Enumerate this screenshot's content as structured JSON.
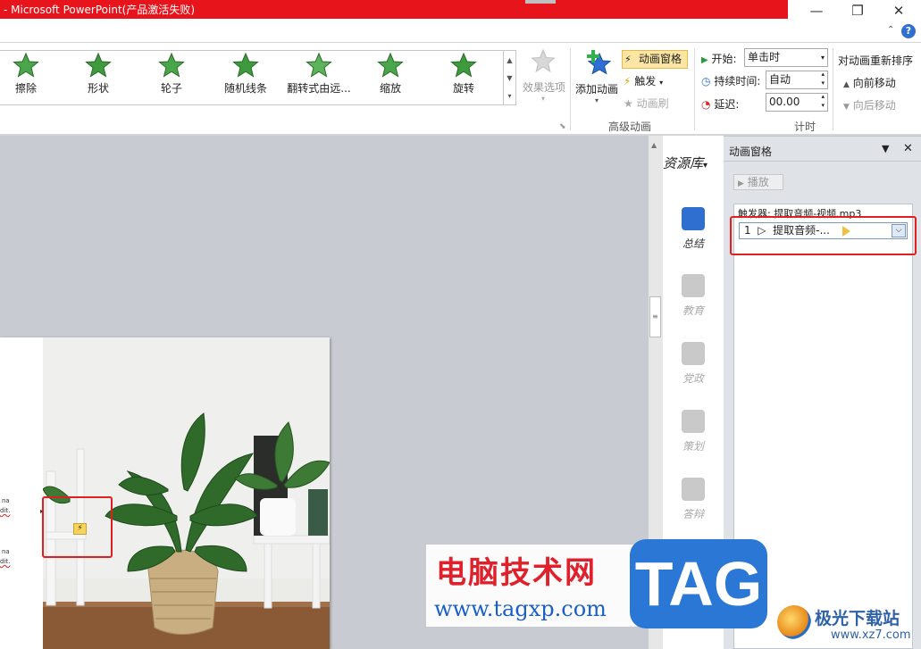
{
  "window": {
    "title": "- Microsoft PowerPoint(产品激活失败)",
    "minimize_icon": "minimize-icon",
    "restore_icon": "restore-icon",
    "close_icon": "close-icon"
  },
  "ribbon": {
    "gallery": [
      {
        "label": "擦除",
        "icon": "star-wipe-icon"
      },
      {
        "label": "形状",
        "icon": "star-shape-icon"
      },
      {
        "label": "轮子",
        "icon": "star-wheel-icon"
      },
      {
        "label": "随机线条",
        "icon": "star-random-bars-icon"
      },
      {
        "label": "翻转式由远...",
        "icon": "star-flip-icon"
      },
      {
        "label": "缩放",
        "icon": "star-zoom-icon"
      },
      {
        "label": "旋转",
        "icon": "star-spin-icon"
      }
    ],
    "effect_options": "效果选项",
    "add_animation": "添加动画",
    "animation_pane_btn": "动画窗格",
    "trigger": "触发",
    "animation_painter": "动画刷",
    "advanced_group": "高级动画",
    "start_label": "开始:",
    "start_value": "单击时",
    "duration_label": "持续时间:",
    "duration_value": "自动",
    "delay_label": "延迟:",
    "delay_value": "00.00",
    "timing_group": "计时",
    "reorder_title": "对动画重新排序",
    "move_earlier": "向前移动",
    "move_later": "向后移动"
  },
  "sidebar": {
    "header": "资源库",
    "items": [
      {
        "label": "总结",
        "active": true
      },
      {
        "label": "教育",
        "active": false
      },
      {
        "label": "党政",
        "active": false
      },
      {
        "label": "策划",
        "active": false
      },
      {
        "label": "答辩",
        "active": false
      }
    ]
  },
  "pane": {
    "title": "动画窗格",
    "play": "播放",
    "trigger_text": "触发器: 提取音频-视频.mp3",
    "item_number": "1",
    "item_text": "提取音频-..."
  },
  "slide": {
    "snippet1": "na",
    "snippet2": "dit.",
    "snippet3": "na",
    "snippet4": "dit."
  },
  "watermark": {
    "cn": "电脑技术网",
    "url": "www.tagxp.com",
    "tag": "TAG",
    "jg": "极光下载站",
    "jg_url": "www.xz7.com"
  }
}
